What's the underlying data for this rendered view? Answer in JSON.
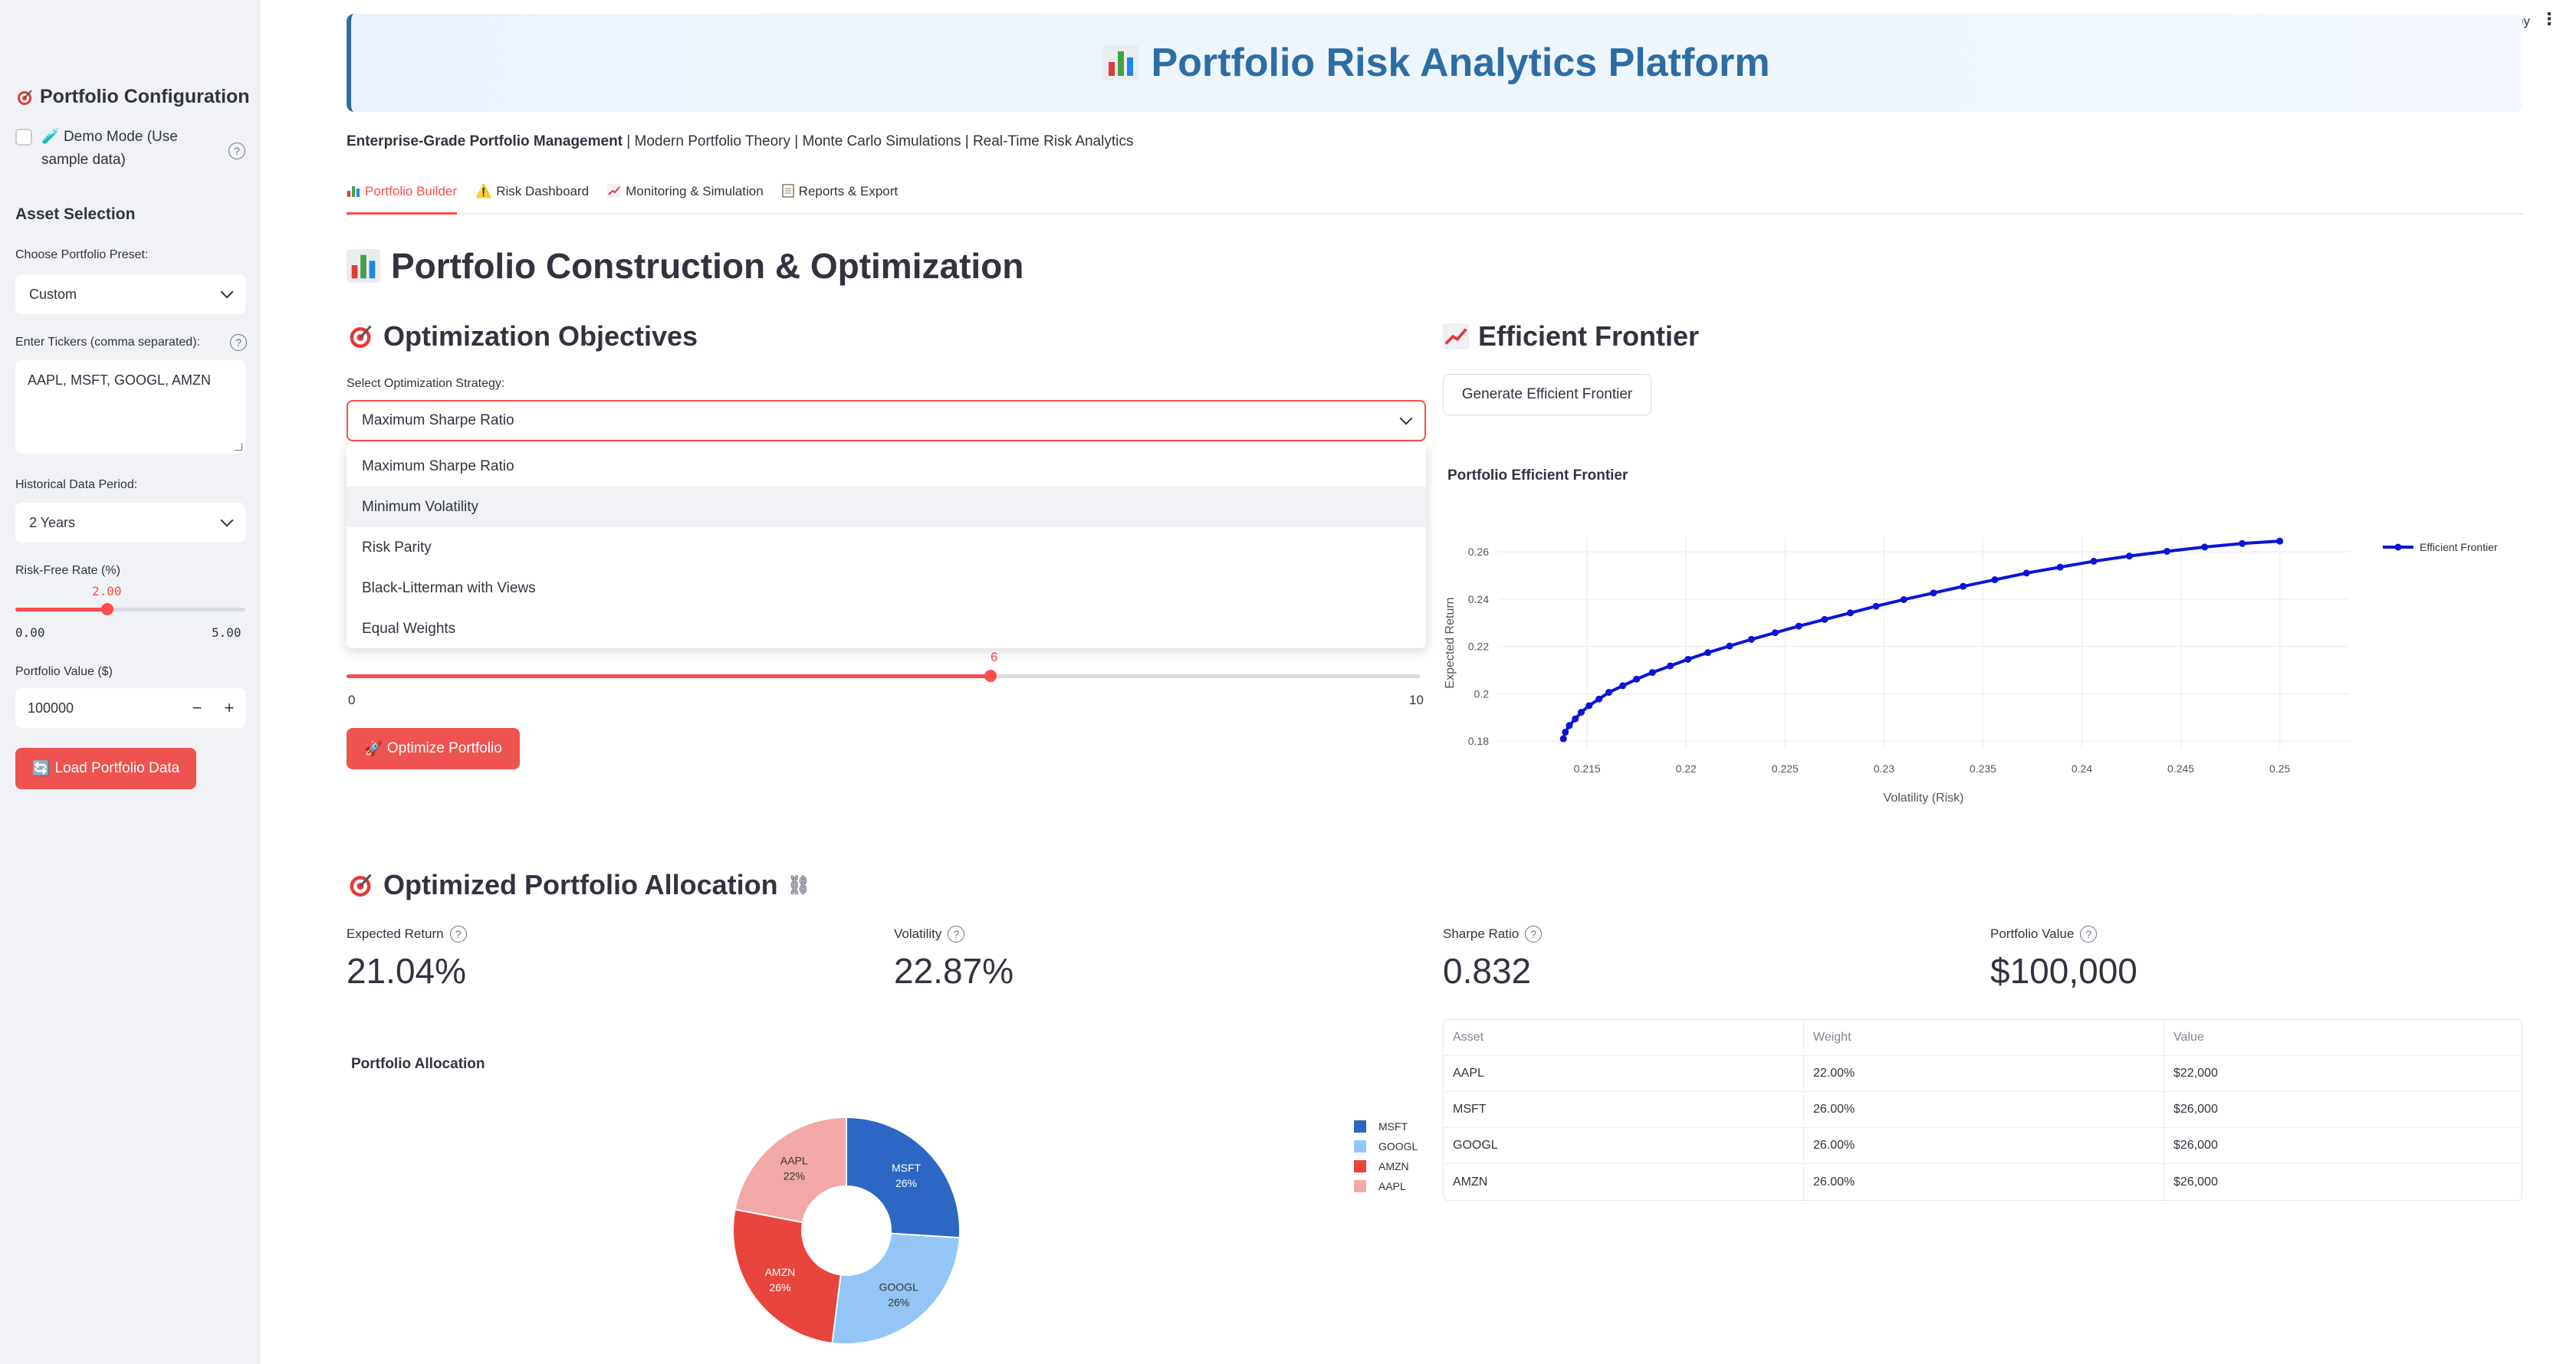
{
  "sidebar": {
    "title": "Portfolio Configuration",
    "demo_mode_label": "Demo Mode (Use sample data)",
    "demo_mode_icon": "test-tube-icon",
    "asset_selection_heading": "Asset Selection",
    "preset_label": "Choose Portfolio Preset:",
    "preset_value": "Custom",
    "tickers_label": "Enter Tickers (comma separated):",
    "tickers_value": "AAPL, MSFT, GOOGL, AMZN",
    "period_label": "Historical Data Period:",
    "period_value": "2 Years",
    "risk_free_label": "Risk-Free Rate (%)",
    "risk_free_value": "2.00",
    "risk_free_value_fraction": 0.4,
    "risk_free_min": "0.00",
    "risk_free_max": "5.00",
    "portfolio_value_label": "Portfolio Value ($)",
    "portfolio_value": "100000",
    "minus": "−",
    "plus": "+",
    "load_button": "Load Portfolio Data",
    "help_glyph": "?"
  },
  "topbar": {
    "deploy": "Deploy",
    "menu_glyph": "⋮"
  },
  "banner": {
    "title": "Portfolio Risk Analytics Platform",
    "icon": "bar-chart-icon"
  },
  "subtitle": {
    "bold": "Enterprise-Grade Portfolio Management",
    "rest": " | Modern Portfolio Theory | Monte Carlo Simulations | Real-Time Risk Analytics"
  },
  "tabs": [
    {
      "label": "Portfolio Builder",
      "icon": "bar-chart-icon",
      "active": true
    },
    {
      "label": "Risk Dashboard",
      "icon": "warning-icon",
      "active": false
    },
    {
      "label": "Monitoring & Simulation",
      "icon": "line-chart-icon",
      "active": false
    },
    {
      "label": "Reports & Export",
      "icon": "document-icon",
      "active": false
    }
  ],
  "main": {
    "heading": "Portfolio Construction & Optimization",
    "objectives_heading": "Optimization Objectives",
    "strategy_label": "Select Optimization Strategy:",
    "strategy_value": "Maximum Sharpe Ratio",
    "strategy_options": [
      "Maximum Sharpe Ratio",
      "Minimum Volatility",
      "Risk Parity",
      "Black-Litterman with Views",
      "Equal Weights"
    ],
    "highlighted_option": "Minimum Volatility",
    "slider_value": "6",
    "slider_value_fraction": 0.6,
    "slider_min": "0",
    "slider_max": "10",
    "optimize_button": "Optimize Portfolio",
    "frontier_heading": "Efficient Frontier",
    "frontier_button": "Generate Efficient Frontier",
    "allocation_heading": "Optimized Portfolio Allocation"
  },
  "metrics": [
    {
      "label": "Expected Return",
      "value": "21.04%"
    },
    {
      "label": "Volatility",
      "value": "22.87%"
    },
    {
      "label": "Sharpe Ratio",
      "value": "0.832"
    },
    {
      "label": "Portfolio Value",
      "value": "$100,000"
    }
  ],
  "table": {
    "headers": [
      "Asset",
      "Weight",
      "Value"
    ],
    "rows": [
      [
        "AAPL",
        "22.00%",
        "$22,000"
      ],
      [
        "MSFT",
        "26.00%",
        "$26,000"
      ],
      [
        "GOOGL",
        "26.00%",
        "$26,000"
      ],
      [
        "AMZN",
        "26.00%",
        "$26,000"
      ]
    ]
  },
  "chart_data": [
    {
      "type": "line",
      "title": "Portfolio Efficient Frontier",
      "xlabel": "Volatility (Risk)",
      "ylabel": "Expected Return",
      "xlim": [
        0.2105,
        0.2535
      ],
      "ylim": [
        0.1765,
        0.2665
      ],
      "xticks": [
        "0.215",
        "0.22",
        "0.225",
        "0.23",
        "0.235",
        "0.24",
        "0.245",
        "0.25"
      ],
      "yticks": [
        "0.18",
        "0.2",
        "0.22",
        "0.24",
        "0.26"
      ],
      "legend": "top-right",
      "series": [
        {
          "name": "Efficient Frontier",
          "color": "#0a15d8",
          "x": [
            0.2138,
            0.2139,
            0.2141,
            0.2144,
            0.2147,
            0.2151,
            0.2156,
            0.2161,
            0.2168,
            0.2175,
            0.2183,
            0.2192,
            0.2201,
            0.2211,
            0.2222,
            0.2233,
            0.2245,
            0.2257,
            0.227,
            0.2283,
            0.2296,
            0.231,
            0.2325,
            0.234,
            0.2356,
            0.2372,
            0.2389,
            0.2406,
            0.2424,
            0.2443,
            0.2462,
            0.2481,
            0.25
          ],
          "y": [
            0.181,
            0.1838,
            0.1866,
            0.1894,
            0.1922,
            0.195,
            0.1978,
            0.2006,
            0.2034,
            0.2062,
            0.209,
            0.2118,
            0.2146,
            0.2174,
            0.2202,
            0.223,
            0.2258,
            0.2286,
            0.2314,
            0.2342,
            0.237,
            0.2398,
            0.2426,
            0.2454,
            0.2482,
            0.251,
            0.2535,
            0.256,
            0.2582,
            0.2602,
            0.262,
            0.2635,
            0.2645
          ]
        }
      ]
    },
    {
      "type": "pie",
      "title": "Portfolio Allocation",
      "labels": [
        "MSFT",
        "GOOGL",
        "AMZN",
        "AAPL"
      ],
      "values": [
        26,
        26,
        26,
        22
      ],
      "slice_labels": [
        "26%",
        "26%",
        "26%",
        "22%"
      ],
      "colors": [
        "#2c68c3",
        "#93c6f6",
        "#e8453c",
        "#f2a8a6"
      ],
      "hole": true,
      "legend": "right"
    }
  ]
}
